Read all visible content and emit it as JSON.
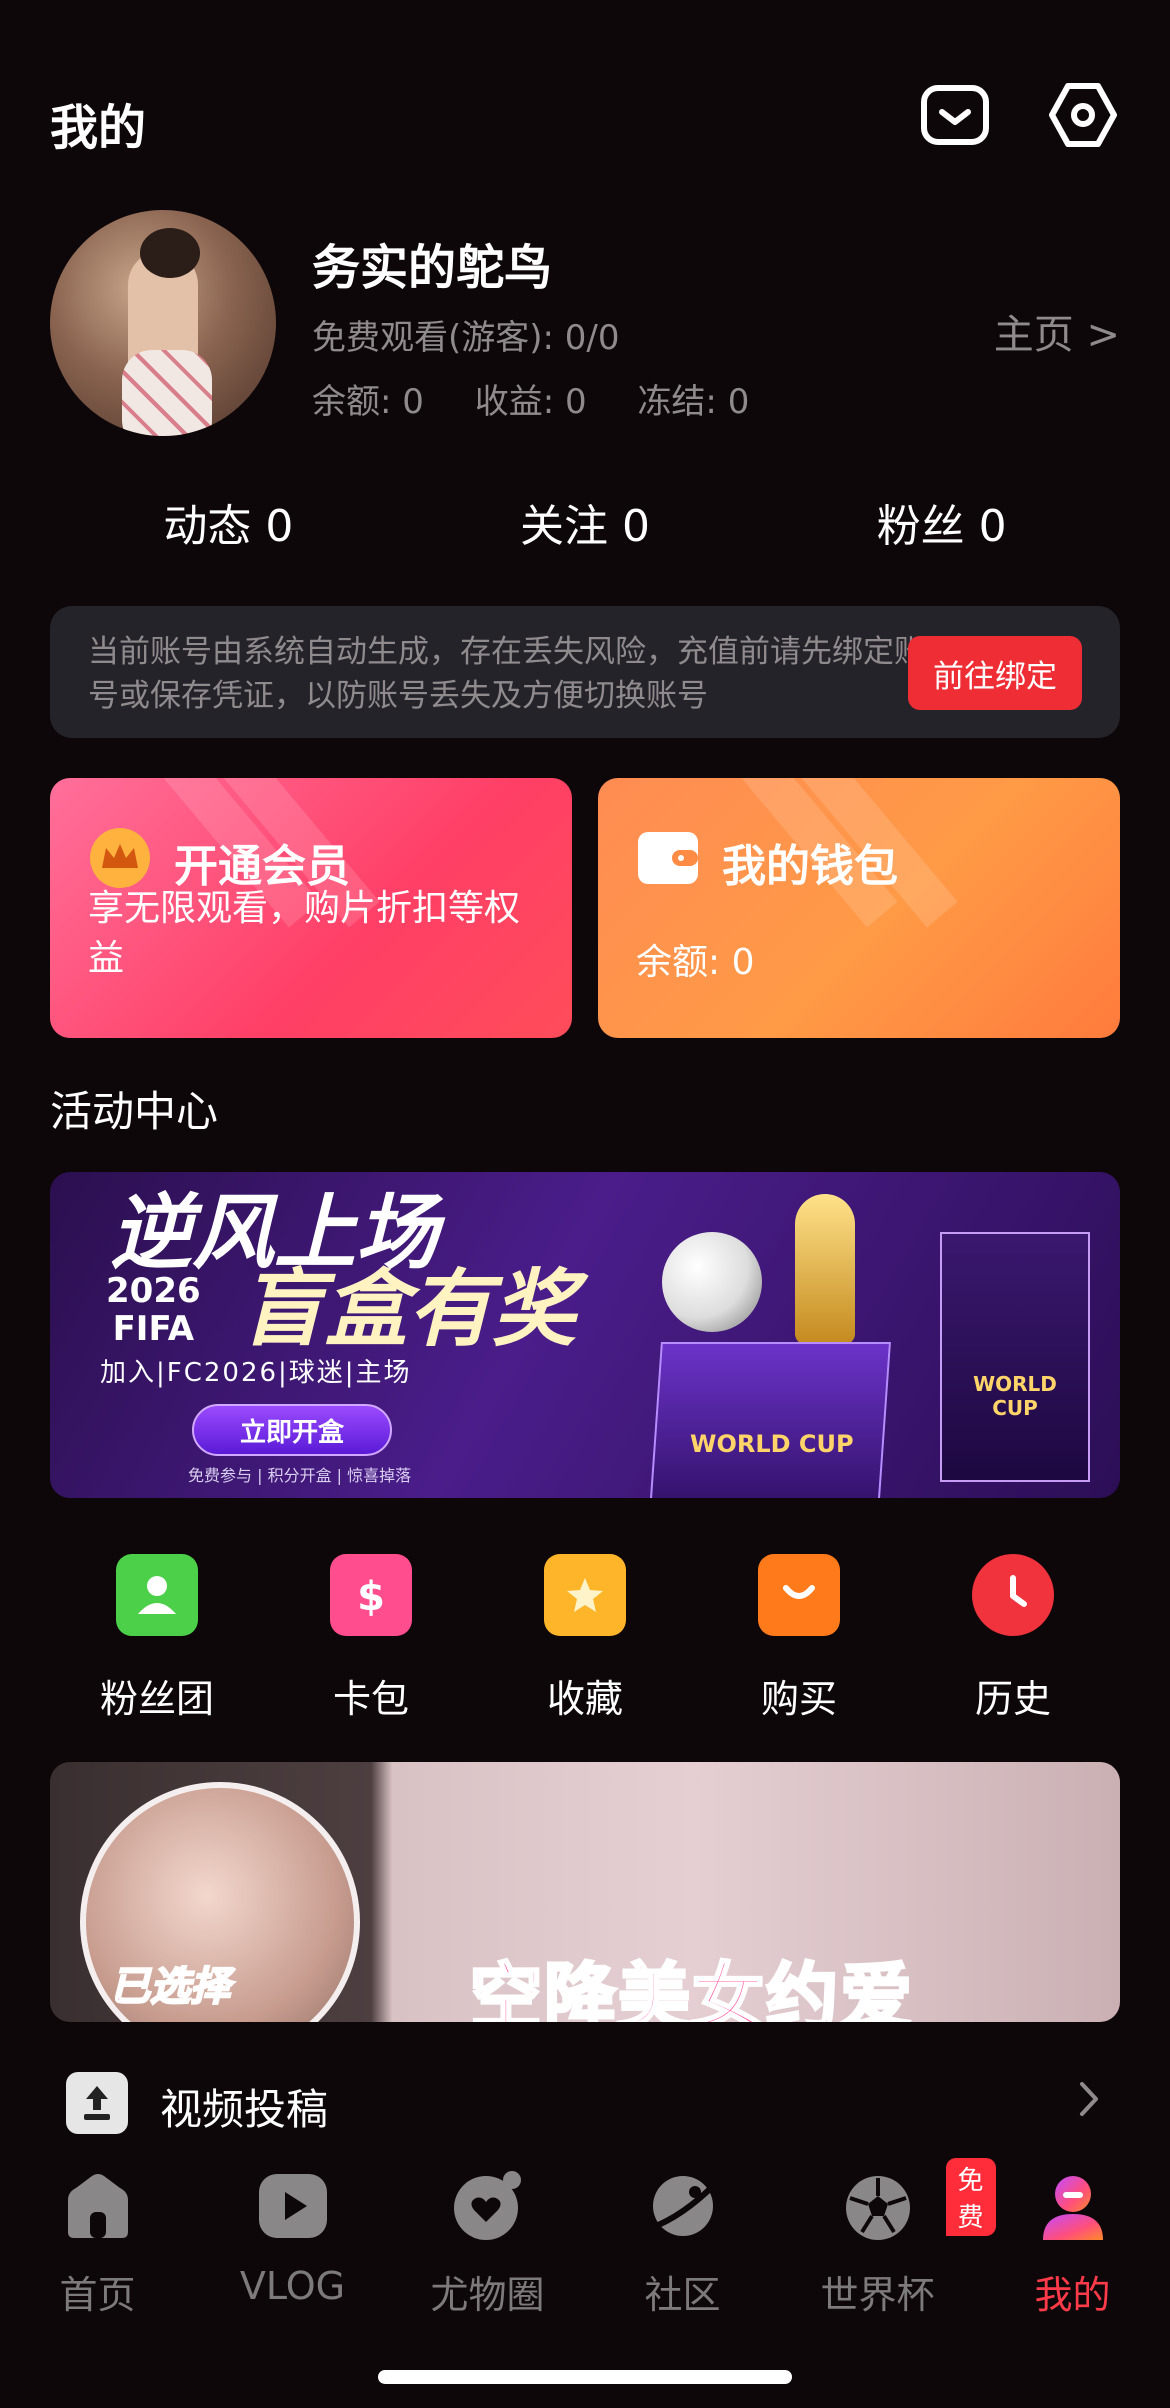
{
  "header": {
    "title": "我的"
  },
  "profile": {
    "nickname": "务实的鸵鸟",
    "free_watch": "免费观看(游客): 0/0",
    "balance": "余额: 0",
    "income": "收益: 0",
    "frozen": "冻结: 0",
    "homepage_link": "主页 >"
  },
  "stats": [
    {
      "label": "动态 0"
    },
    {
      "label": "关注 0"
    },
    {
      "label": "粉丝 0"
    }
  ],
  "notice": {
    "text": "当前账号由系统自动生成，存在丢失风险，充值前请先绑定账号或保存凭证，以防账号丢失及方便切换账号",
    "button": "前往绑定"
  },
  "cards": {
    "vip": {
      "title": "开通会员",
      "desc": "享无限观看，购片折扣等权益"
    },
    "wallet": {
      "title": "我的钱包",
      "desc": "余额: 0"
    }
  },
  "activity": {
    "section_title": "活动中心",
    "banner": {
      "headline1": "逆风上场",
      "headline2": "盲盒有奖",
      "year": "2026",
      "fifa": "FIFA",
      "tagline": "加入|FC2026|球迷|主场",
      "button": "立即开盒",
      "small": "免费参与 | 积分开盒 | 惊喜掉落",
      "box_text": "WORLD CUP",
      "tall_text": "WORLD CUP"
    }
  },
  "shortcuts": [
    {
      "label": "粉丝团",
      "icon": "fan-club-icon",
      "color": "#4cd04a"
    },
    {
      "label": "卡包",
      "icon": "card-wallet-icon",
      "color": "#ff4d8d"
    },
    {
      "label": "收藏",
      "icon": "favorites-icon",
      "color": "#ffb52a"
    },
    {
      "label": "购买",
      "icon": "shopping-bag-icon",
      "color": "#ff7a1a"
    },
    {
      "label": "历史",
      "icon": "history-clock-icon",
      "color": "#f0333d"
    }
  ],
  "ad": {
    "chosen": "已选择",
    "headline": "空降美女约爱"
  },
  "video_submit": {
    "label": "视频投稿"
  },
  "tabs": [
    {
      "label": "首页",
      "icon": "home-icon"
    },
    {
      "label": "VLOG",
      "icon": "play-icon"
    },
    {
      "label": "尤物圈",
      "icon": "heart-bubble-icon"
    },
    {
      "label": "社区",
      "icon": "planet-icon"
    },
    {
      "label": "世界杯",
      "icon": "soccer-ball-icon",
      "badge": "免费"
    },
    {
      "label": "我的",
      "icon": "profile-icon",
      "active": true
    }
  ]
}
